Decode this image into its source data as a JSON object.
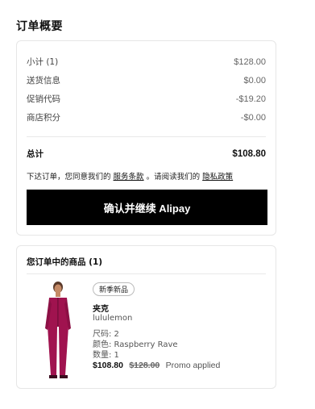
{
  "page": {
    "title": "订单概要"
  },
  "summary": {
    "subtotal": {
      "label": "小计 (1)",
      "value": "$128.00"
    },
    "shipping": {
      "label": "送货信息",
      "value": "$0.00"
    },
    "promo": {
      "label": "促销代码",
      "value": "-$19.20"
    },
    "credit": {
      "label": "商店积分",
      "value": "-$0.00"
    },
    "total": {
      "label": "总计",
      "value": "$108.80"
    },
    "terms": {
      "prefix": "下达订单，您同意我们的",
      "service_link": "服务条款",
      "middle": "。请阅读我们的",
      "privacy_link": "隐私政策"
    },
    "pay_button": "确认并继续 Alipay"
  },
  "items": {
    "heading": "您订单中的商品 (1)",
    "product": {
      "badge": "新季新品",
      "name": "夹克",
      "brand": "lululemon",
      "size": "尺码: 2",
      "color": "颜色: Raspberry Rave",
      "quantity": "数量: 1",
      "price_now": "$108.80",
      "price_old": "$128.00",
      "promo_note": "Promo applied"
    }
  },
  "colors": {
    "button_bg": "#000000",
    "jacket": "#a0134f"
  }
}
